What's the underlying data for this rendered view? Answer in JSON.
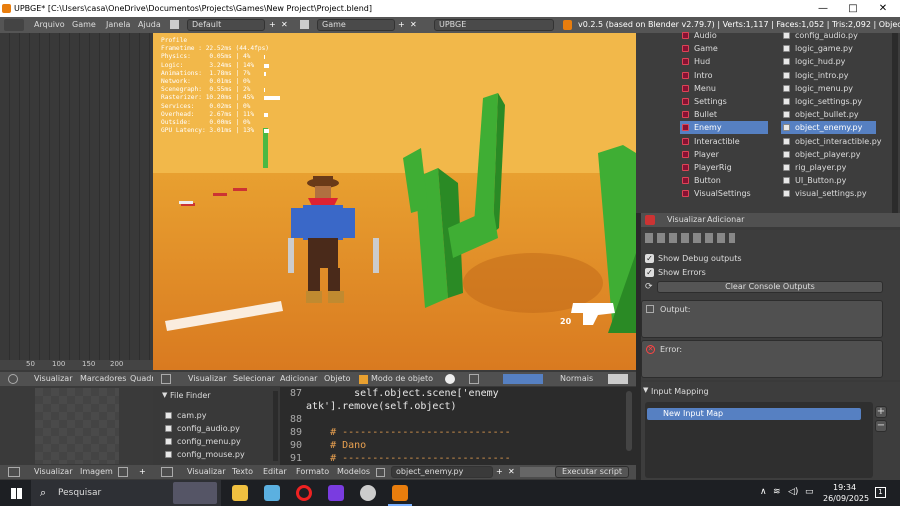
{
  "titlebar": {
    "title": "UPBGE* [C:\\Users\\casa\\OneDrive\\Documentos\\Projects\\Games\\New Project\\Project.blend]",
    "min": "—",
    "max": "□",
    "close": "✕"
  },
  "menubar": {
    "items": [
      "Arquivo",
      "Game",
      "Janela",
      "Ajuda"
    ],
    "layout": "Default",
    "scene": "Game",
    "engine": "UPBGE",
    "stats": "v0.2.5 (based on Blender v2.79.7) | Verts:1,117 | Faces:1,052 | Tris:2,092 | Objects:0/38"
  },
  "timeline": {
    "ticks": [
      "50",
      "100",
      "150",
      "200"
    ]
  },
  "profile": {
    "header": "Profile",
    "rows": [
      {
        "label": "Frametime : 22.52ms (44.4fps)",
        "pct": 0
      },
      {
        "label": "Physics:     0.05ms | 4%",
        "pct": 4
      },
      {
        "label": "Logic:       3.24ms | 14%",
        "pct": 14
      },
      {
        "label": "Animations:  1.78ms | 7%",
        "pct": 7
      },
      {
        "label": "Network:     0.01ms | 0%",
        "pct": 0
      },
      {
        "label": "Scenegraph:  0.55ms | 2%",
        "pct": 2
      },
      {
        "label": "Rasterizer: 10.20ms | 45%",
        "pct": 45
      },
      {
        "label": "Services:    0.02ms | 0%",
        "pct": 0
      },
      {
        "label": "Overhead:    2.67ms | 11%",
        "pct": 11
      },
      {
        "label": "Outside:     0.00ms | 0%",
        "pct": 0
      },
      {
        "label": "GPU Latency: 3.01ms | 13%",
        "pct": 13
      }
    ]
  },
  "hud": {
    "ammo": "20"
  },
  "outliner": {
    "scenes": [
      "Audio",
      "Game",
      "Hud",
      "Intro",
      "Menu",
      "Settings",
      "Bullet",
      "Enemy",
      "Interactible",
      "Player",
      "PlayerRig",
      "Button",
      "VisualSettings"
    ],
    "scripts": [
      "config_audio.py",
      "logic_game.py",
      "logic_hud.py",
      "logic_intro.py",
      "logic_menu.py",
      "logic_settings.py",
      "object_bullet.py",
      "object_enemy.py",
      "object_interactible.py",
      "object_player.py",
      "rig_player.py",
      "UI_Button.py",
      "visual_settings.py"
    ],
    "selected_index": 7
  },
  "props_header": {
    "items": [
      "Visualizar",
      "Adicionar"
    ]
  },
  "props": {
    "show_debug": "Show Debug outputs",
    "show_errors": "Show Errors",
    "clear_btn": "Clear Console Outputs",
    "output_label": "Output:",
    "error_label": "Error:"
  },
  "inputmap": {
    "title": "Input Mapping",
    "item": "New Input Map",
    "add": "+",
    "remove": "−"
  },
  "viewport_header": {
    "items": [
      "Visualizar",
      "Selecionar",
      "Adicionar",
      "Objeto"
    ],
    "mode": "Modo de objeto",
    "shading": "Normais"
  },
  "left_header": {
    "items": [
      "Visualizar",
      "Marcadores",
      "Quadro"
    ]
  },
  "filefinder": {
    "title": "File Finder",
    "files": [
      "cam.py",
      "config_audio.py",
      "config_menu.py",
      "config_mouse.py"
    ]
  },
  "texteditor": {
    "lines": [
      {
        "n": "87",
        "t": "        self.object.scene['enemy"
      },
      {
        "n": "",
        "t": "atk'].remove(self.object)"
      },
      {
        "n": "88",
        "t": ""
      },
      {
        "n": "89",
        "t": "    # ----------------------------"
      },
      {
        "n": "90",
        "t": "    # Dano"
      },
      {
        "n": "91",
        "t": "    # ----------------------------"
      }
    ]
  },
  "bottom_header": {
    "left": [
      "Visualizar",
      "Imagem"
    ],
    "mid": [
      "Visualizar",
      "Texto",
      "Editar",
      "Formato",
      "Modelos"
    ],
    "filename": "object_enemy.py",
    "run": "Executar script"
  },
  "taskbar": {
    "search": "Pesquisar",
    "time": "19:34",
    "date": "26/09/2025",
    "notif": "1"
  },
  "colors": {
    "accent": "#5680c2",
    "blender_orange": "#e87d0d",
    "selection": "#5680c2"
  }
}
